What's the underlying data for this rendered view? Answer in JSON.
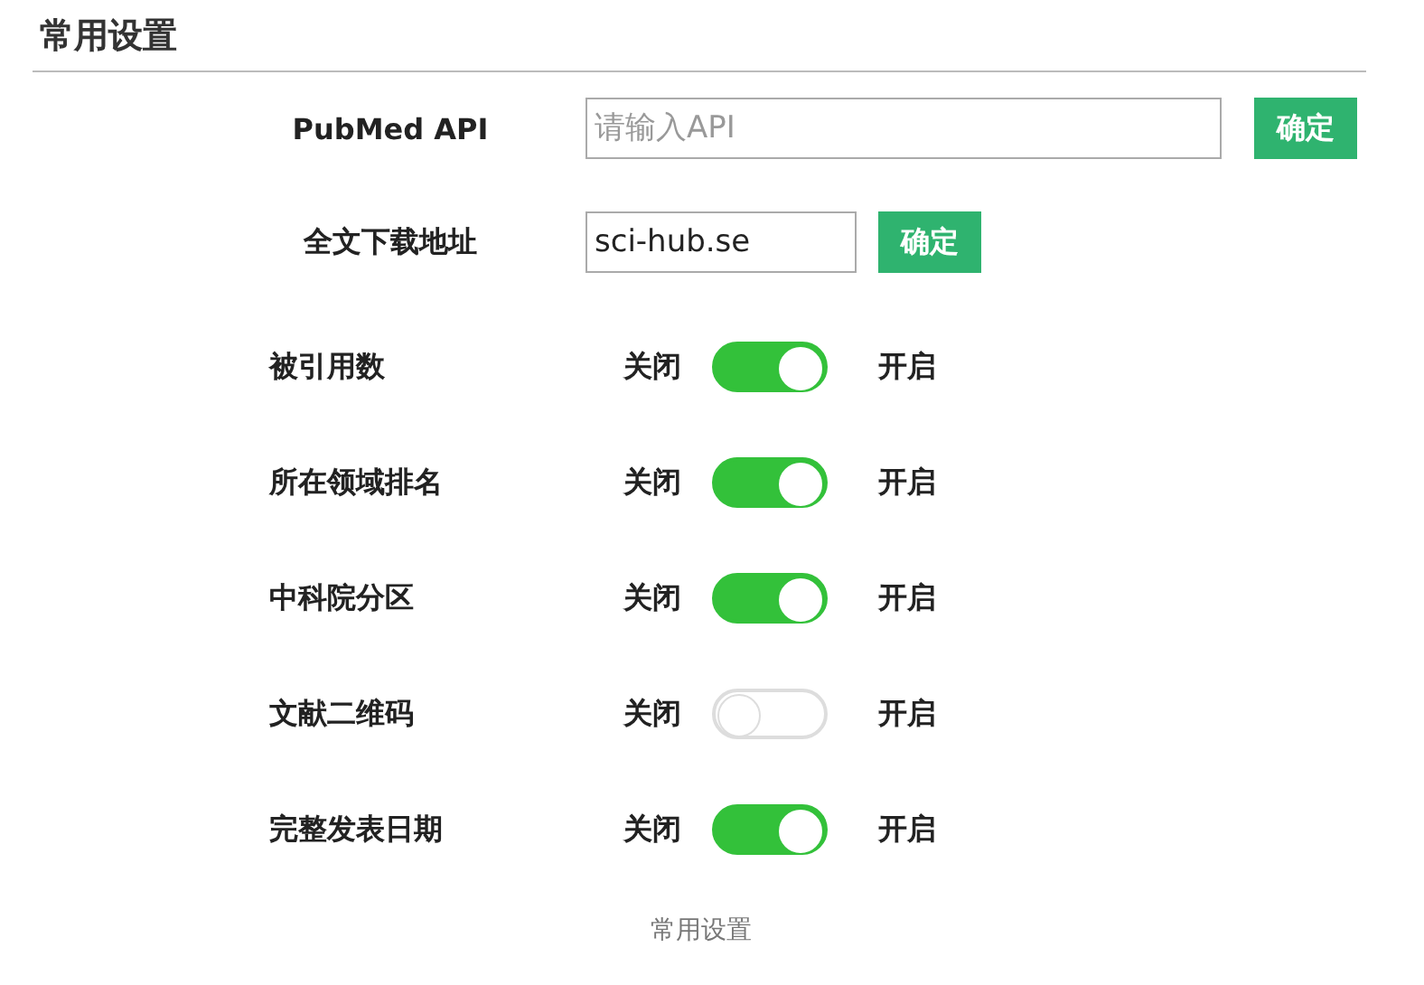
{
  "title": "常用设置",
  "fields": [
    {
      "label": "PubMed API",
      "placeholder": "请输入API",
      "button": "确定",
      "wide": true
    },
    {
      "label": "全文下载地址",
      "value": "sci-hub.se",
      "button": "确定",
      "wide": false
    }
  ],
  "switches": [
    {
      "label": "被引用数",
      "off_label": "关闭",
      "on_label": "开启",
      "on": true
    },
    {
      "label": "所在领域排名",
      "off_label": "关闭",
      "on_label": "开启",
      "on": true
    },
    {
      "label": "中科院分区",
      "off_label": "关闭",
      "on_label": "开启",
      "on": true
    },
    {
      "label": "文献二维码",
      "off_label": "关闭",
      "on_label": "开启",
      "on": false
    },
    {
      "label": "完整发表日期",
      "off_label": "关闭",
      "on_label": "开启",
      "on": true
    }
  ],
  "footer": "常用设置"
}
